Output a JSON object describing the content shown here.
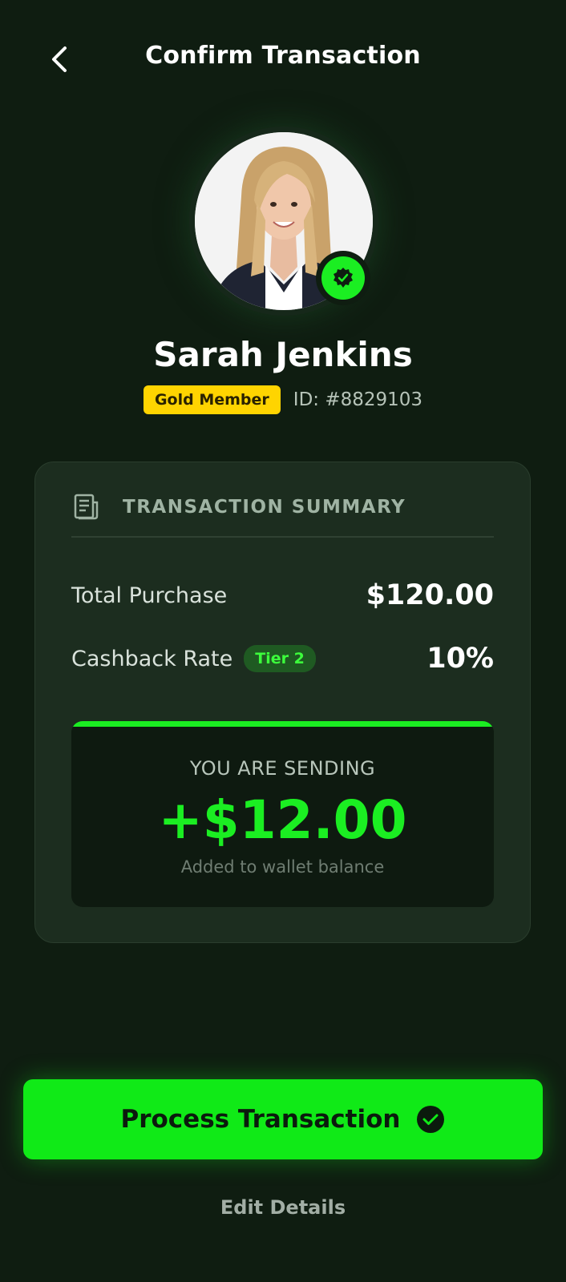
{
  "header": {
    "title": "Confirm Transaction",
    "back_icon": "chevron-left-icon"
  },
  "profile": {
    "name": "Sarah Jenkins",
    "member_badge": "Gold Member",
    "member_id": "ID: #8829103",
    "verified_icon": "verified-check-icon"
  },
  "summary": {
    "title": "TRANSACTION SUMMARY",
    "icon": "receipt-icon",
    "purchase_label": "Total Purchase",
    "purchase_value": "$120.00",
    "rate_label": "Cashback Rate",
    "tier_badge": "Tier 2",
    "rate_value": "10%"
  },
  "sending": {
    "label": "YOU ARE SENDING",
    "amount": "+$12.00",
    "note": "Added to wallet balance"
  },
  "actions": {
    "process_label": "Process Transaction",
    "edit_label": "Edit Details"
  },
  "colors": {
    "background": "#0f1d11",
    "accent": "#1bee22",
    "card": "#1c2d1f",
    "gold": "#ffd400"
  }
}
